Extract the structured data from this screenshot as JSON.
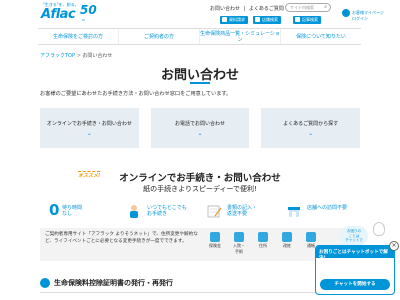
{
  "header": {
    "slogan": "\"生きる\"を、創る。",
    "logo": "Aflac",
    "anniversary": "50",
    "anniversary_sub": "th",
    "toplinks": [
      "お問い合わせ",
      "よくあるご質問"
    ],
    "search_placeholder": "サイト内検索",
    "chips": [
      "資料請求",
      "店舗検索",
      "記事検索"
    ],
    "login_label": "お客様マイページ",
    "login_sub": "ログイン"
  },
  "nav": {
    "items": [
      "生命保険をご検討の方",
      "ご契約者の方",
      "生命保険商品一覧・シミュレーション",
      "保険について知りたい"
    ]
  },
  "breadcrumb": {
    "home": "アフラックTOP",
    "sep": ">",
    "current": "お問い合わせ"
  },
  "page": {
    "title": "お問い合わせ",
    "intro": "お客様のご要望にあわせたお手続き方法・お問い合わせ窓口をご用意しています。",
    "cards": [
      {
        "label": "オンラインでお手続き・お問い合わせ",
        "chev": "⌄"
      },
      {
        "label": "お電話でお問い合わせ",
        "chev": "⌄"
      },
      {
        "label": "よくあるご質問から探す",
        "chev": "⌄"
      }
    ]
  },
  "online": {
    "tag": "オススメ!",
    "title": "オンラインでお手続き・お問い合わせ",
    "subtitle": "紙の手続きよりスピーディーで便利!",
    "features": [
      {
        "big": "0",
        "label": "待ち時間\nなし"
      },
      {
        "label": "いつでもどこでも\nお手続き"
      },
      {
        "label": "書類の記入・\n返送不要"
      },
      {
        "label": "店舗への訪問不要"
      }
    ],
    "note": "ご契約者専用サイト「アフラック よりそうネット」で、住所変更や解約など、ライフイベントごとに必要となる変更手続きが一度でできます。",
    "icons": [
      "保険金",
      "入院・手術",
      "住所",
      "改姓",
      "通帳"
    ]
  },
  "section": {
    "title": "生命保険料控除証明書の発行・再発行"
  },
  "chat": {
    "bubble": "お困りの\nことは\nチャットで",
    "header": "お困りごとはチャットボットで解決!",
    "close": "×",
    "button": "チャットを開始する"
  }
}
